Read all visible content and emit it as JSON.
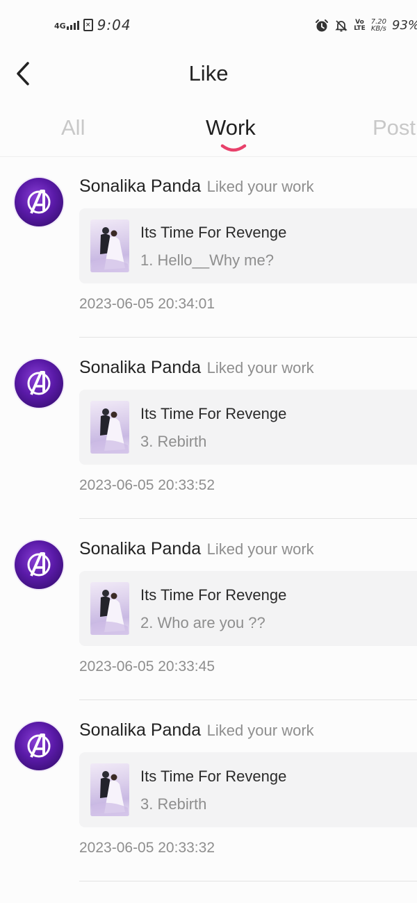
{
  "status_bar": {
    "network": "4G",
    "sim_badge": "×",
    "time": "9:04",
    "volte": "Vo\nLTE",
    "speed": "7.20\nKB/s",
    "battery": "93%"
  },
  "header": {
    "title": "Like"
  },
  "tabs": [
    {
      "label": "All",
      "active": false
    },
    {
      "label": "Work",
      "active": true
    },
    {
      "label": "Post",
      "active": false
    }
  ],
  "colors": {
    "accent": "#e8416b",
    "avatar": "#5a1aa8",
    "card_bg": "#f3f3f4"
  },
  "notifications": [
    {
      "user": "Sonalika Panda",
      "action": "Liked your work",
      "work_title": "Its Time For Revenge",
      "chapter": "1. Hello__Why me?",
      "timestamp": "2023-06-05 20:34:01"
    },
    {
      "user": "Sonalika Panda",
      "action": "Liked your work",
      "work_title": "Its Time For Revenge",
      "chapter": "3. Rebirth",
      "timestamp": "2023-06-05 20:33:52"
    },
    {
      "user": "Sonalika Panda",
      "action": "Liked your work",
      "work_title": "Its Time For Revenge",
      "chapter": "2. Who are you ??",
      "timestamp": "2023-06-05 20:33:45"
    },
    {
      "user": "Sonalika Panda",
      "action": "Liked your work",
      "work_title": "Its Time For Revenge",
      "chapter": "3. Rebirth",
      "timestamp": "2023-06-05 20:33:32"
    }
  ]
}
